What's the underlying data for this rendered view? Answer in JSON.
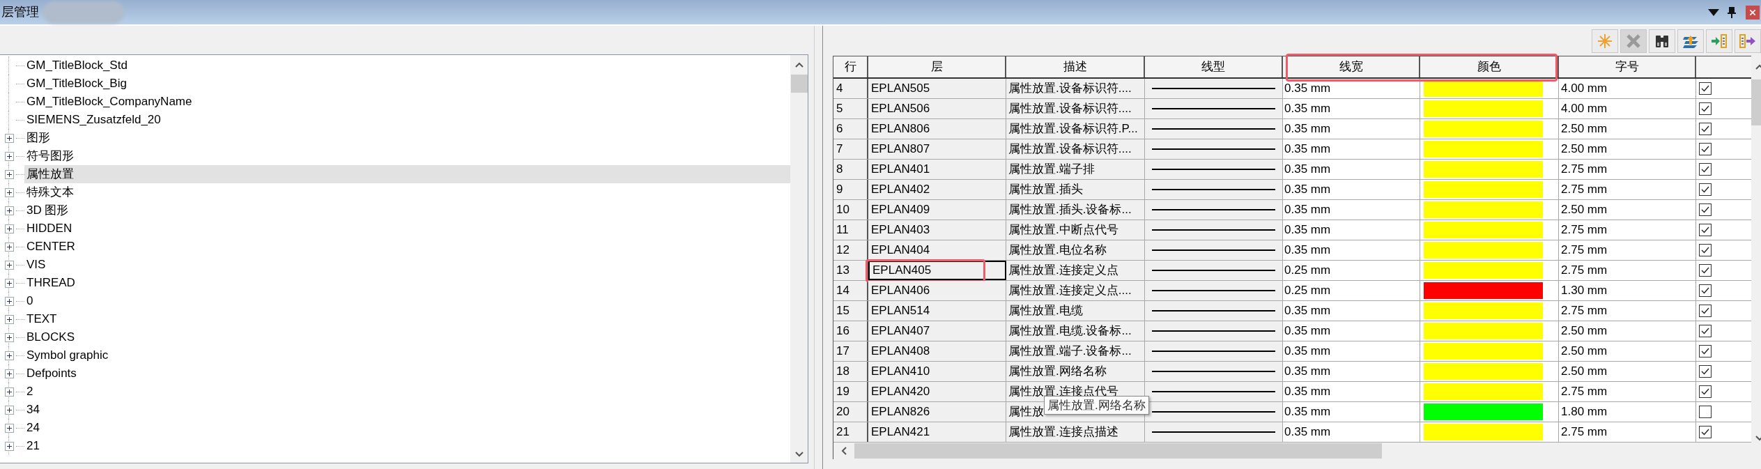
{
  "window": {
    "title": "层管理"
  },
  "toolbar": [
    {
      "kind": "new",
      "disabled": false
    },
    {
      "kind": "delete",
      "disabled": true
    },
    {
      "kind": "find",
      "disabled": false
    },
    {
      "kind": "layers",
      "disabled": false
    },
    {
      "kind": "import",
      "disabled": false
    },
    {
      "kind": "export",
      "disabled": false
    }
  ],
  "tree": {
    "items": [
      {
        "label": "GM_TitleBlock_Std",
        "expandable": false,
        "selected": false
      },
      {
        "label": "GM_TitleBlock_Big",
        "expandable": false,
        "selected": false
      },
      {
        "label": "GM_TitleBlock_CompanyName",
        "expandable": false,
        "selected": false
      },
      {
        "label": "SIEMENS_Zusatzfeld_20",
        "expandable": false,
        "selected": false
      },
      {
        "label": "图形",
        "expandable": true,
        "selected": false
      },
      {
        "label": "符号图形",
        "expandable": true,
        "selected": false
      },
      {
        "label": "属性放置",
        "expandable": true,
        "selected": true
      },
      {
        "label": "特殊文本",
        "expandable": true,
        "selected": false
      },
      {
        "label": "3D 图形",
        "expandable": true,
        "selected": false
      },
      {
        "label": "HIDDEN",
        "expandable": true,
        "selected": false
      },
      {
        "label": "CENTER",
        "expandable": true,
        "selected": false
      },
      {
        "label": "VIS",
        "expandable": true,
        "selected": false
      },
      {
        "label": "THREAD",
        "expandable": true,
        "selected": false
      },
      {
        "label": "0",
        "expandable": true,
        "selected": false
      },
      {
        "label": "TEXT",
        "expandable": true,
        "selected": false
      },
      {
        "label": "BLOCKS",
        "expandable": true,
        "selected": false
      },
      {
        "label": "Symbol graphic",
        "expandable": true,
        "selected": false
      },
      {
        "label": "Defpoints",
        "expandable": true,
        "selected": false
      },
      {
        "label": "2",
        "expandable": true,
        "selected": false
      },
      {
        "label": "34",
        "expandable": true,
        "selected": false
      },
      {
        "label": "24",
        "expandable": true,
        "selected": false
      },
      {
        "label": "21",
        "expandable": true,
        "selected": false
      }
    ]
  },
  "table": {
    "columns": [
      {
        "label": "行"
      },
      {
        "label": "层"
      },
      {
        "label": "描述"
      },
      {
        "label": "线型"
      },
      {
        "label": "线宽",
        "annotated": true
      },
      {
        "label": "颜色",
        "annotated": true
      },
      {
        "label": "字号"
      }
    ],
    "rows": [
      {
        "row": "4",
        "layer": "EPLAN505",
        "description": "属性放置.设备标识符....",
        "line_width": "0.35 mm",
        "color": "#ffff00",
        "font_size": "4.00 mm",
        "checked": true,
        "selected": false
      },
      {
        "row": "5",
        "layer": "EPLAN506",
        "description": "属性放置.设备标识符....",
        "line_width": "0.35 mm",
        "color": "#ffff00",
        "font_size": "4.00 mm",
        "checked": true,
        "selected": false
      },
      {
        "row": "6",
        "layer": "EPLAN806",
        "description": "属性放置.设备标识符.P...",
        "line_width": "0.35 mm",
        "color": "#ffff00",
        "font_size": "2.50 mm",
        "checked": true,
        "selected": false
      },
      {
        "row": "7",
        "layer": "EPLAN807",
        "description": "属性放置.设备标识符....",
        "line_width": "0.35 mm",
        "color": "#ffff00",
        "font_size": "2.50 mm",
        "checked": true,
        "selected": false
      },
      {
        "row": "8",
        "layer": "EPLAN401",
        "description": "属性放置.端子排",
        "line_width": "0.35 mm",
        "color": "#ffff00",
        "font_size": "2.75 mm",
        "checked": true,
        "selected": false
      },
      {
        "row": "9",
        "layer": "EPLAN402",
        "description": "属性放置.插头",
        "line_width": "0.35 mm",
        "color": "#ffff00",
        "font_size": "2.75 mm",
        "checked": true,
        "selected": false
      },
      {
        "row": "10",
        "layer": "EPLAN409",
        "description": "属性放置.插头.设备标...",
        "line_width": "0.35 mm",
        "color": "#ffff00",
        "font_size": "2.50 mm",
        "checked": true,
        "selected": false
      },
      {
        "row": "11",
        "layer": "EPLAN403",
        "description": "属性放置.中断点代号",
        "line_width": "0.35 mm",
        "color": "#ffff00",
        "font_size": "2.75 mm",
        "checked": true,
        "selected": false
      },
      {
        "row": "12",
        "layer": "EPLAN404",
        "description": "属性放置.电位名称",
        "line_width": "0.35 mm",
        "color": "#ffff00",
        "font_size": "2.75 mm",
        "checked": true,
        "selected": false
      },
      {
        "row": "13",
        "layer": "EPLAN405",
        "description": "属性放置.连接定义点",
        "line_width": "0.25 mm",
        "color": "#ffff00",
        "font_size": "2.75 mm",
        "checked": true,
        "selected": true,
        "annotated": true
      },
      {
        "row": "14",
        "layer": "EPLAN406",
        "description": "属性放置.连接定义点....",
        "line_width": "0.25 mm",
        "color": "#ff0000",
        "font_size": "1.30 mm",
        "checked": true,
        "selected": false
      },
      {
        "row": "15",
        "layer": "EPLAN514",
        "description": "属性放置.电缆",
        "line_width": "0.35 mm",
        "color": "#ffff00",
        "font_size": "2.75 mm",
        "checked": true,
        "selected": false
      },
      {
        "row": "16",
        "layer": "EPLAN407",
        "description": "属性放置.电缆.设备标...",
        "line_width": "0.35 mm",
        "color": "#ffff00",
        "font_size": "2.50 mm",
        "checked": true,
        "selected": false
      },
      {
        "row": "17",
        "layer": "EPLAN408",
        "description": "属性放置.端子.设备标...",
        "line_width": "0.35 mm",
        "color": "#ffff00",
        "font_size": "2.50 mm",
        "checked": true,
        "selected": false
      },
      {
        "row": "18",
        "layer": "EPLAN410",
        "description": "属性放置.网络名称",
        "line_width": "0.35 mm",
        "color": "#ffff00",
        "font_size": "2.50 mm",
        "checked": true,
        "selected": false
      },
      {
        "row": "19",
        "layer": "EPLAN420",
        "description": "属性放置.连接点代号",
        "line_width": "0.35 mm",
        "color": "#ffff00",
        "font_size": "2.75 mm",
        "checked": true,
        "selected": false
      },
      {
        "row": "20",
        "layer": "EPLAN826",
        "description": "属性放",
        "line_width": "0.35 mm",
        "color": "#00ff00",
        "font_size": "1.80 mm",
        "checked": false,
        "selected": false
      },
      {
        "row": "21",
        "layer": "EPLAN421",
        "description": "属性放置.连接点描述",
        "line_width": "0.35 mm",
        "color": "#ffff00",
        "font_size": "2.75 mm",
        "checked": true,
        "selected": false
      }
    ]
  },
  "tooltip": {
    "text": "属性放置.网络名称"
  }
}
